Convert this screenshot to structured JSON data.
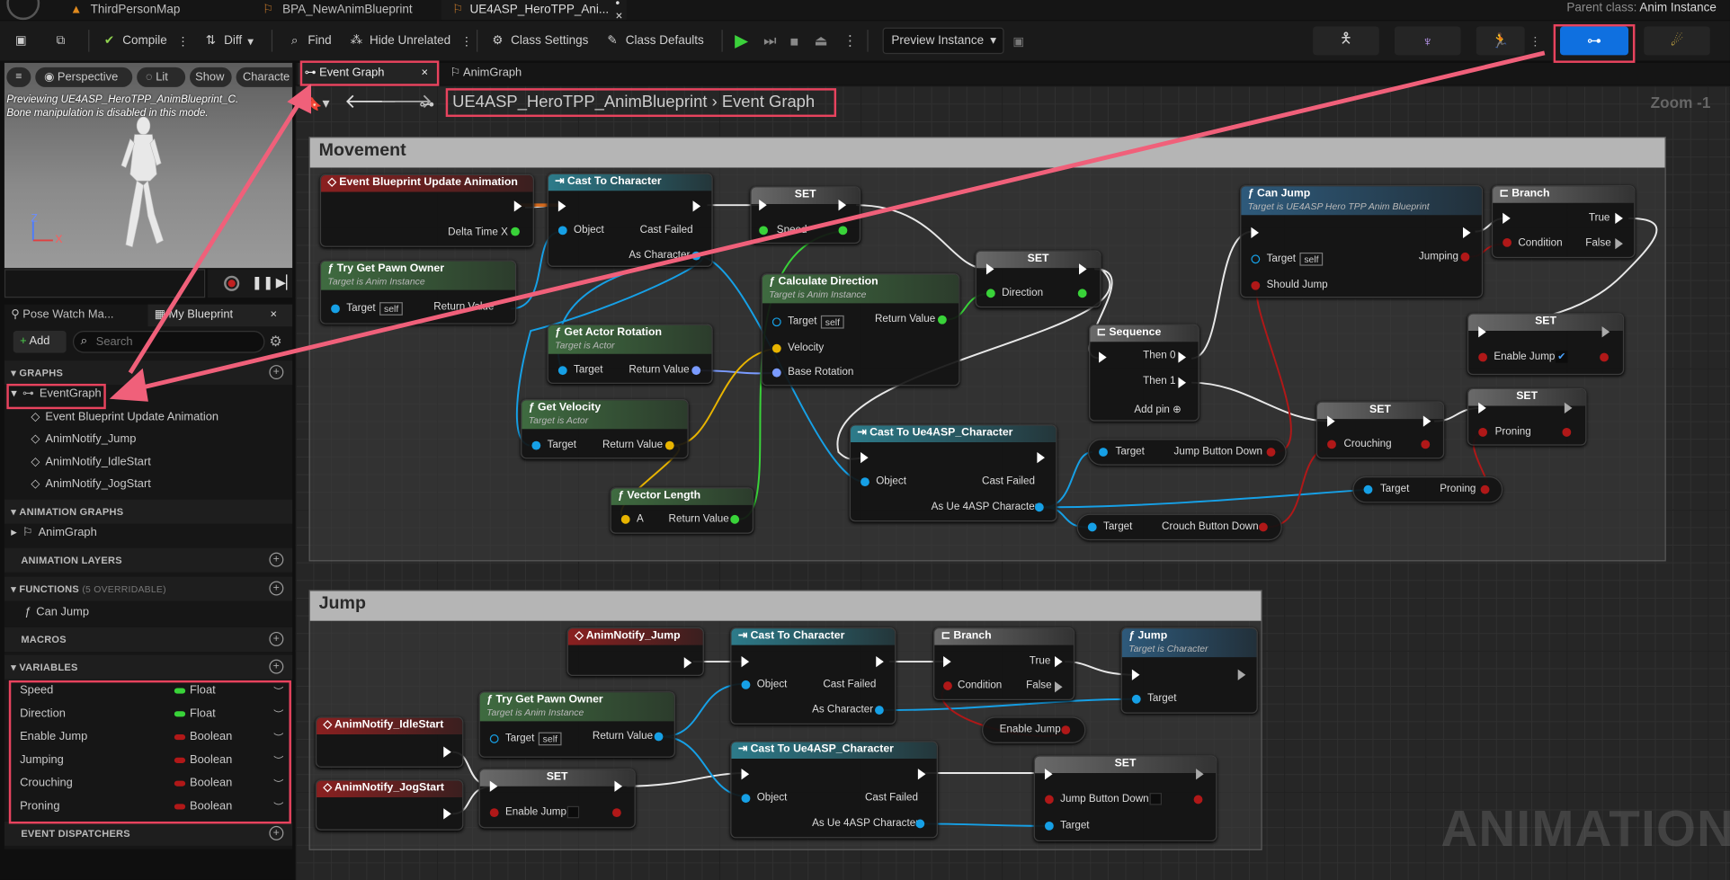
{
  "tabs": {
    "map": "ThirdPersonMap",
    "bp": "BPA_NewAnimBlueprint",
    "hero": "UE4ASP_HeroTPP_Ani...",
    "hero_dirty": "• ×"
  },
  "parent": {
    "label": "Parent class:",
    "value": "Anim Instance"
  },
  "toolbar": {
    "compile": "Compile",
    "diff": "Diff",
    "find": "Find",
    "hide": "Hide Unrelated",
    "class_settings": "Class Settings",
    "class_defaults": "Class Defaults",
    "preview": "Preview Instance"
  },
  "viewport": {
    "perspective": "Perspective",
    "lit": "Lit",
    "show": "Show",
    "character": "Characte",
    "msg1": "Previewing UE4ASP_HeroTPP_AnimBlueprint_C.",
    "msg2": "Bone manipulation is disabled in this mode.",
    "z": "Z",
    "x": "X"
  },
  "doc_tabs": {
    "event_graph": "Event Graph",
    "close": "×",
    "anim_graph": "AnimGraph"
  },
  "breadcrumb": {
    "bp": "UE4ASP_HeroTPP_AnimBlueprint",
    "graph": "Event Graph",
    "zoom": "Zoom -1"
  },
  "panel": {
    "pose_watch": "Pose Watch Ma...",
    "my_blueprint": "My Blueprint",
    "close": "×",
    "add": "Add",
    "search_placeholder": "Search"
  },
  "sections": {
    "graphs": "GRAPHS",
    "anim_graphs": "ANIMATION GRAPHS",
    "anim_layers": "ANIMATION LAYERS",
    "functions": "FUNCTIONS",
    "functions_note": "(5 OVERRIDABLE)",
    "macros": "MACROS",
    "variables": "VARIABLES",
    "dispatchers": "EVENT DISPATCHERS"
  },
  "graphs": {
    "root": "EventGraph",
    "items": [
      "Event Blueprint Update Animation",
      "AnimNotify_Jump",
      "AnimNotify_IdleStart",
      "AnimNotify_JogStart"
    ]
  },
  "anim_graph": "AnimGraph",
  "function": "Can Jump",
  "variables": [
    {
      "name": "Speed",
      "type": "Float",
      "color": "#39d339"
    },
    {
      "name": "Direction",
      "type": "Float",
      "color": "#39d339"
    },
    {
      "name": "Enable Jump",
      "type": "Boolean",
      "color": "#b01818"
    },
    {
      "name": "Jumping",
      "type": "Boolean",
      "color": "#b01818"
    },
    {
      "name": "Crouching",
      "type": "Boolean",
      "color": "#b01818"
    },
    {
      "name": "Proning",
      "type": "Boolean",
      "color": "#b01818"
    }
  ],
  "comments": {
    "movement": "Movement",
    "jump": "Jump"
  },
  "watermark": "ANIMATION",
  "nodes": {
    "event_update": "Event Blueprint Update Animation",
    "delta": "Delta Time X",
    "try_get": "Try Get Pawn Owner",
    "anim_inst": "Target is Anim Instance",
    "target": "Target",
    "self": "self",
    "return_value": "Return Value",
    "cast_char": "Cast To Character",
    "object": "Object",
    "cast_failed": "Cast Failed",
    "as_char": "As Character",
    "set": "SET",
    "speed": "Speed",
    "direction": "Direction",
    "calc_dir": "Calculate Direction",
    "velocity": "Velocity",
    "base_rot": "Base Rotation",
    "get_rot": "Get Actor Rotation",
    "target_actor": "Target is Actor",
    "get_vel": "Get Velocity",
    "vec_len": "Vector Length",
    "a": "A",
    "cast_ue4": "Cast To Ue4ASP_Character",
    "as_ue4": "As Ue 4ASP Character",
    "sequence": "Sequence",
    "then0": "Then 0",
    "then1": "Then 1",
    "add_pin": "Add pin",
    "can_jump": "Can Jump",
    "can_jump_sub": "Target is UE4ASP Hero TPP Anim Blueprint",
    "jumping": "Jumping",
    "should_jump": "Should Jump",
    "branch": "Branch",
    "true": "True",
    "false": "False",
    "condition": "Condition",
    "enable_jump": "Enable Jump",
    "crouching": "Crouching",
    "proning": "Proning",
    "jump_btn": "Jump Button Down",
    "crouch_btn": "Crouch Button Down",
    "notify_jump": "AnimNotify_Jump",
    "notify_idle": "AnimNotify_IdleStart",
    "notify_jog": "AnimNotify_JogStart",
    "jump": "Jump",
    "jump_sub": "Target is Character"
  }
}
